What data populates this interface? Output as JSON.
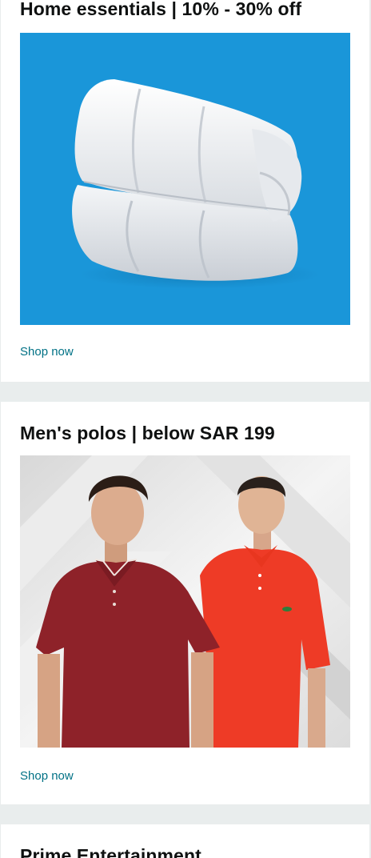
{
  "cards": [
    {
      "title": "Home essentials | 10% - 30% off",
      "image_alt": "rolled white duvet on blue background",
      "link_label": "Shop now"
    },
    {
      "title": "Men's polos | below SAR 199",
      "image_alt": "two men wearing polo shirts, maroon and orange",
      "link_label": "Shop now"
    },
    {
      "title": "Prime Entertainment"
    }
  ],
  "colors": {
    "page_background": "#e9eded",
    "card_background": "#ffffff",
    "link": "#007185",
    "blue_banner": "#1a96d9",
    "maroon_polo": "#8e2229",
    "orange_polo": "#ee3b26"
  }
}
